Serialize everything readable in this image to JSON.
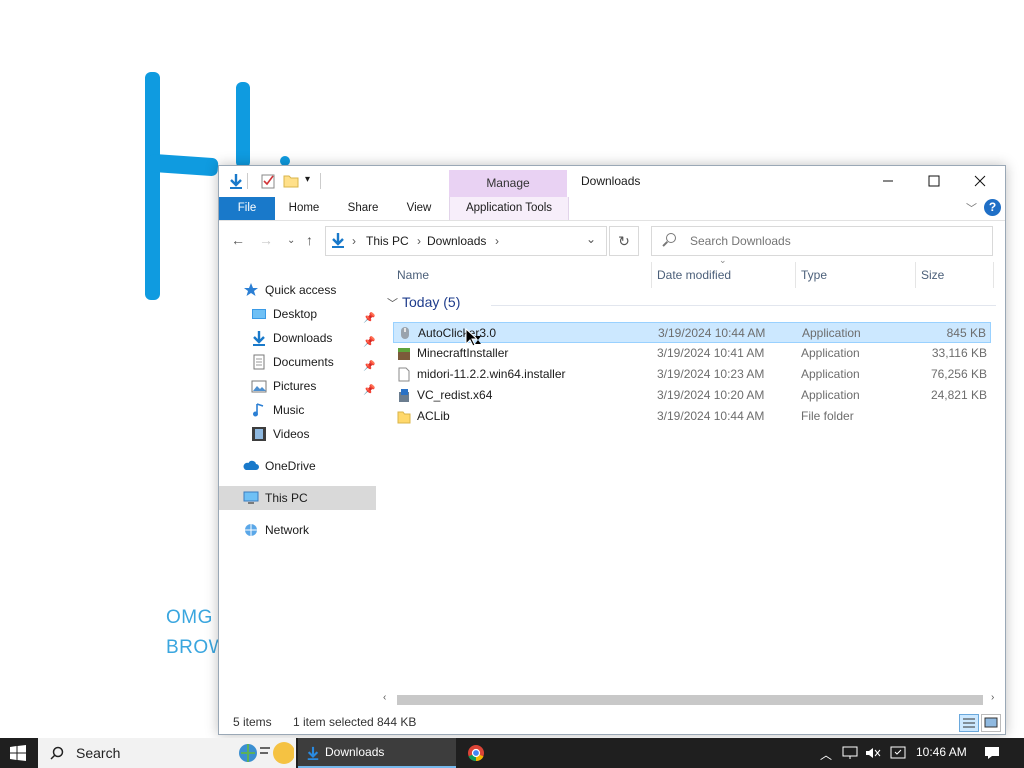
{
  "desktop": {
    "omg_line1": "OMG",
    "omg_line2": "BROW"
  },
  "window": {
    "title": "Downloads",
    "manage_tab": "Manage",
    "ribbon_tabs": [
      "File",
      "Home",
      "Share",
      "View",
      "Application Tools"
    ],
    "breadcrumb": [
      "This PC",
      "Downloads"
    ],
    "search_placeholder": "Search Downloads"
  },
  "nav_pane": {
    "items": [
      {
        "label": "Quick access",
        "icon": "star-icon",
        "pinned": false
      },
      {
        "label": "Desktop",
        "icon": "desktop-folder-icon",
        "pinned": true
      },
      {
        "label": "Downloads",
        "icon": "download-arrow-icon",
        "pinned": true
      },
      {
        "label": "Documents",
        "icon": "documents-icon",
        "pinned": true
      },
      {
        "label": "Pictures",
        "icon": "pictures-icon",
        "pinned": true
      },
      {
        "label": "Music",
        "icon": "music-note-icon",
        "pinned": false
      },
      {
        "label": "Videos",
        "icon": "video-film-icon",
        "pinned": false
      },
      {
        "label": "OneDrive",
        "icon": "cloud-icon",
        "pinned": false
      },
      {
        "label": "This PC",
        "icon": "computer-icon",
        "pinned": false,
        "selected": true
      },
      {
        "label": "Network",
        "icon": "network-icon",
        "pinned": false
      }
    ]
  },
  "file_list": {
    "columns": [
      "Name",
      "Date modified",
      "Type",
      "Size"
    ],
    "group_header": "Today (5)",
    "rows": [
      {
        "name": "AutoClicker3.0",
        "date": "3/19/2024 10:44 AM",
        "type": "Application",
        "size": "845 KB",
        "selected": true
      },
      {
        "name": "MinecraftInstaller",
        "date": "3/19/2024 10:41 AM",
        "type": "Application",
        "size": "33,116 KB"
      },
      {
        "name": "midori-11.2.2.win64.installer",
        "date": "3/19/2024 10:23 AM",
        "type": "Application",
        "size": "76,256 KB"
      },
      {
        "name": "VC_redist.x64",
        "date": "3/19/2024 10:20 AM",
        "type": "Application",
        "size": "24,821 KB"
      },
      {
        "name": "ACLib",
        "date": "3/19/2024 10:44 AM",
        "type": "File folder",
        "size": ""
      }
    ]
  },
  "status_bar": {
    "items_count": "5 items",
    "selection": "1 item selected",
    "selection_size": "844 KB"
  },
  "taskbar": {
    "search_label": "Search",
    "open_window_label": "Downloads",
    "clock": "10:46 AM"
  },
  "colors": {
    "accent": "#1979ca",
    "selection": "#cce8ff",
    "manage_tab": "#e9d2f3",
    "taskbar": "#1f1f1f"
  }
}
